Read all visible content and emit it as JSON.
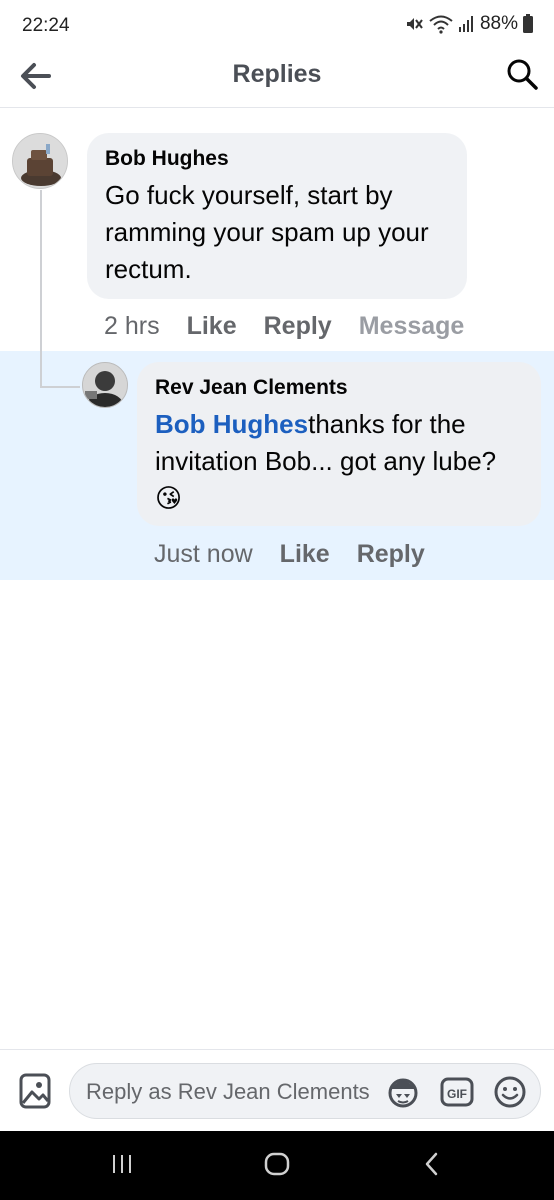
{
  "status_bar": {
    "time": "22:24",
    "battery": "88%",
    "icons": [
      "mute-icon",
      "wifi-icon",
      "signal-icon",
      "battery-icon"
    ]
  },
  "header": {
    "title": "Replies",
    "back_icon": "back-arrow-icon",
    "search_icon": "search-icon"
  },
  "comments": [
    {
      "author": "Bob Hughes",
      "text": "Go fuck yourself, start by ramming your spam up your rectum.",
      "time": "2 hrs",
      "actions": [
        "Like",
        "Reply",
        "Message"
      ]
    },
    {
      "author": "Rev Jean Clements",
      "mention": "Bob Hughes",
      "text": "Bob Hughes thanks for the invitation Bob... got any lube?",
      "emoji": "😘",
      "time": "Just now",
      "actions": [
        "Like",
        "Reply"
      ],
      "highlighted": true
    }
  ],
  "composer": {
    "placeholder": "Reply as Rev Jean Clements",
    "gif_label": "GIF",
    "icons": [
      "photo-icon",
      "avatar-sticker-icon",
      "gif-icon",
      "emoji-icon"
    ]
  },
  "nav_bar": {
    "icons": [
      "recents-icon",
      "home-icon",
      "back-icon"
    ]
  },
  "colors": {
    "highlight": "#e7f3ff",
    "mention": "#1c5fbf",
    "bubble": "#f0f2f5",
    "secondary_text": "#65676b"
  }
}
